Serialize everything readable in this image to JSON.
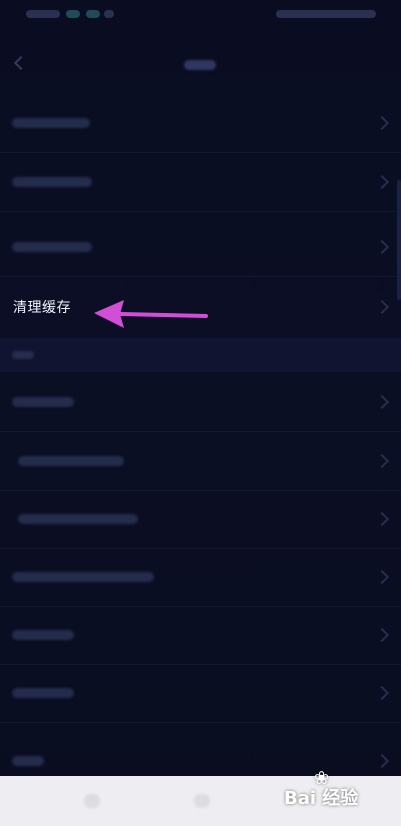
{
  "main": {
    "highlighted_item": {
      "label": "清理缓存"
    }
  },
  "watermark": {
    "text": "Bai 经验"
  },
  "colors": {
    "background": "#0b0e22",
    "highlight_text": "#f0f2ff",
    "arrow": "#d24ed6",
    "bottom_bar": "#eeeef2"
  }
}
